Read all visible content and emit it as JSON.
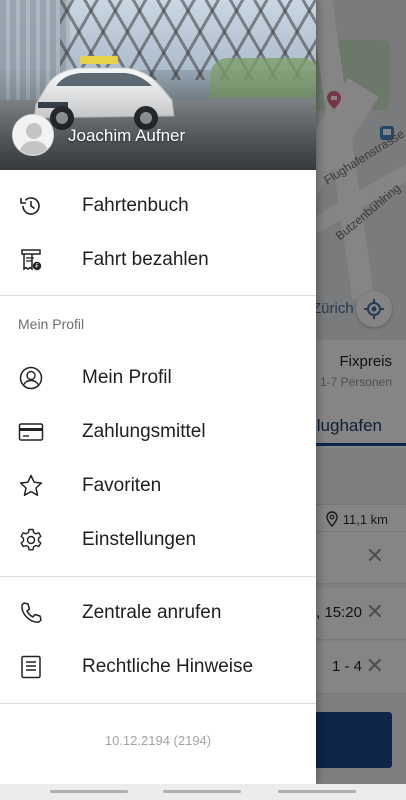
{
  "drawer": {
    "user_name": "Joachim Aufner",
    "menu_primary": [
      {
        "label": "Fahrtenbuch",
        "icon": "history-icon"
      },
      {
        "label": "Fahrt bezahlen",
        "icon": "receipt-icon"
      }
    ],
    "section_title": "Mein Profil",
    "menu_profile": [
      {
        "label": "Mein Profil",
        "icon": "user-outline-icon"
      },
      {
        "label": "Zahlungsmittel",
        "icon": "credit-card-icon"
      },
      {
        "label": "Favoriten",
        "icon": "star-icon"
      },
      {
        "label": "Einstellungen",
        "icon": "gear-icon"
      }
    ],
    "menu_secondary": [
      {
        "label": "Zentrale anrufen",
        "icon": "phone-icon"
      },
      {
        "label": "Rechtliche Hinweise",
        "icon": "document-icon"
      }
    ],
    "version": "10.12.2194 (2194)"
  },
  "background": {
    "map_labels": [
      "Flughafenstrasse",
      "Butzenbühlring",
      "Zürich"
    ],
    "fare_title": "Fixpreis",
    "fare_subtitle": "1-7 Personen",
    "active_tab": "Flughafen",
    "distance": "11,1 km",
    "time_value": ", 15:20",
    "passengers_value": "1 - 4",
    "colors": {
      "accent": "#1a4a8a",
      "scrim": "rgba(0,0,0,0.48)"
    }
  }
}
